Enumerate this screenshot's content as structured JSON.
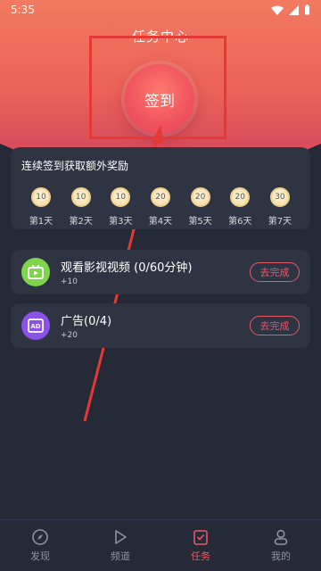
{
  "status_bar": {
    "time": "5:35"
  },
  "page": {
    "title": "任务中心"
  },
  "sign_in": {
    "label": "签到"
  },
  "checkin": {
    "title": "连续签到获取额外奖励",
    "days": [
      {
        "coins": "10",
        "label": "第1天"
      },
      {
        "coins": "10",
        "label": "第2天"
      },
      {
        "coins": "10",
        "label": "第3天"
      },
      {
        "coins": "20",
        "label": "第4天"
      },
      {
        "coins": "20",
        "label": "第5天"
      },
      {
        "coins": "20",
        "label": "第6天"
      },
      {
        "coins": "30",
        "label": "第7天"
      }
    ]
  },
  "tasks": [
    {
      "name": "观看影视视频 (0/60分钟)",
      "reward": "+10",
      "button": "去完成",
      "icon": "tv-icon",
      "icon_color": "#7ed44a"
    },
    {
      "name": "广告(0/4)",
      "reward": "+20",
      "button": "去完成",
      "icon": "ad-icon",
      "icon_color": "#8a52e8"
    }
  ],
  "tab_bar": {
    "active": "tasks",
    "tabs": [
      {
        "id": "discover",
        "label": "发现",
        "icon": "compass-icon"
      },
      {
        "id": "channel",
        "label": "频道",
        "icon": "play-icon"
      },
      {
        "id": "tasks",
        "label": "任务",
        "icon": "task-icon"
      },
      {
        "id": "mine",
        "label": "我的",
        "icon": "user-icon"
      }
    ]
  },
  "colors": {
    "accent": "#e8596a",
    "card": "#2f3442",
    "background": "#262a37",
    "annotation": "#e53935"
  }
}
